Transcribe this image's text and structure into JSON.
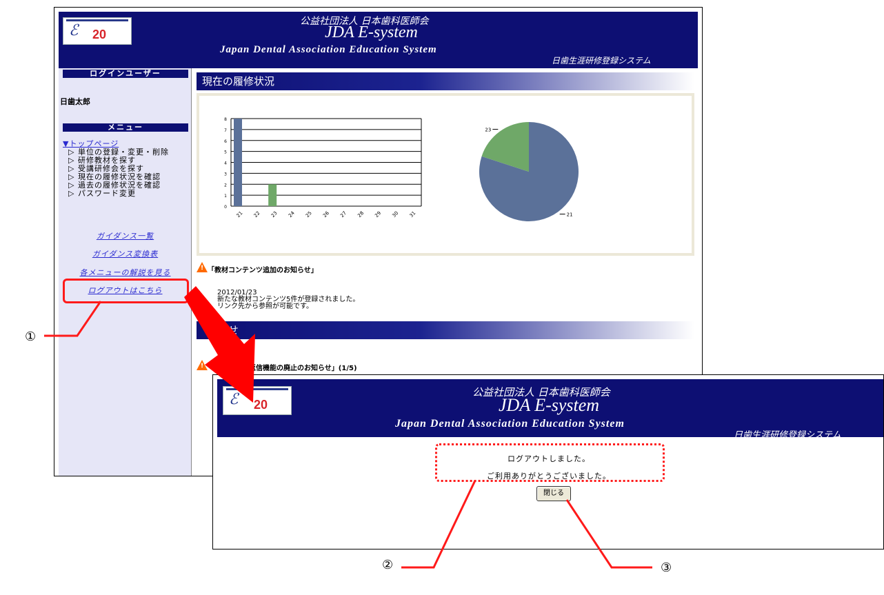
{
  "banner": {
    "org": "公益社団法人 日本歯科医師会",
    "title": "JDA E-system",
    "subtitle": "Japan  Dental  Association  Education  System",
    "right": "日歯生涯研修登録システム",
    "logo_num": "20"
  },
  "sidebar": {
    "login_header": "ログインユーザー",
    "user_name": "日歯太郎",
    "menu_header": "メニュー",
    "top_page": "▼トップページ",
    "items": [
      "▷ 単位の登録・変更・削除",
      "▷ 研修教材を探す",
      "▷ 受講研修会を探す",
      "▷ 現在の履修状況を確認",
      "▷ 過去の履修状況を確認",
      "▷ パスワード変更"
    ],
    "links": [
      "ガイダンス一覧",
      "ガイダンス変換表",
      "各メニューの解説を見る",
      "ログアウトはこちら"
    ]
  },
  "main": {
    "section1": "現在の履修状況",
    "notice1_title": "「教材コンテンツ追加のお知らせ」",
    "notice1_date": "2012/01/23",
    "notice1_line1": "新たな教材コンテンツ5件が登録されました。",
    "notice1_line2": "リンク先から参照が可能です。",
    "section2": "知らせ",
    "notice2_title": "自動返信機能の廃止のお知らせ」(1/5)"
  },
  "logout_window": {
    "msg1": "ログアウトしました。",
    "msg2": "ご利用ありがとうございました。",
    "close_label": "閉じる"
  },
  "annotations": [
    "①",
    "②",
    "③"
  ],
  "colors": {
    "banner": "#0d0f73",
    "highlight": "#ff1a1a",
    "bar_blue": "#5b7199",
    "bar_green": "#6fa868",
    "warning": "#ff6a00"
  },
  "chart_data": [
    {
      "type": "bar",
      "categories": [
        "21",
        "22",
        "23",
        "24",
        "25",
        "26",
        "27",
        "28",
        "29",
        "30",
        "31"
      ],
      "values": [
        8,
        0,
        2,
        0,
        0,
        0,
        0,
        0,
        0,
        0,
        0
      ],
      "bar_colors": [
        "#5b7199",
        "#5b7199",
        "#6fa868",
        "#5b7199",
        "#5b7199",
        "#5b7199",
        "#5b7199",
        "#5b7199",
        "#5b7199",
        "#5b7199",
        "#5b7199"
      ],
      "ylim": [
        0,
        8
      ],
      "yticks": [
        0,
        1,
        2,
        3,
        4,
        5,
        6,
        7,
        8
      ],
      "grid": true
    },
    {
      "type": "pie",
      "slices": [
        {
          "label": "21",
          "value": 8,
          "color": "#5b7199"
        },
        {
          "label": "23",
          "value": 2,
          "color": "#6fa868"
        }
      ]
    }
  ]
}
